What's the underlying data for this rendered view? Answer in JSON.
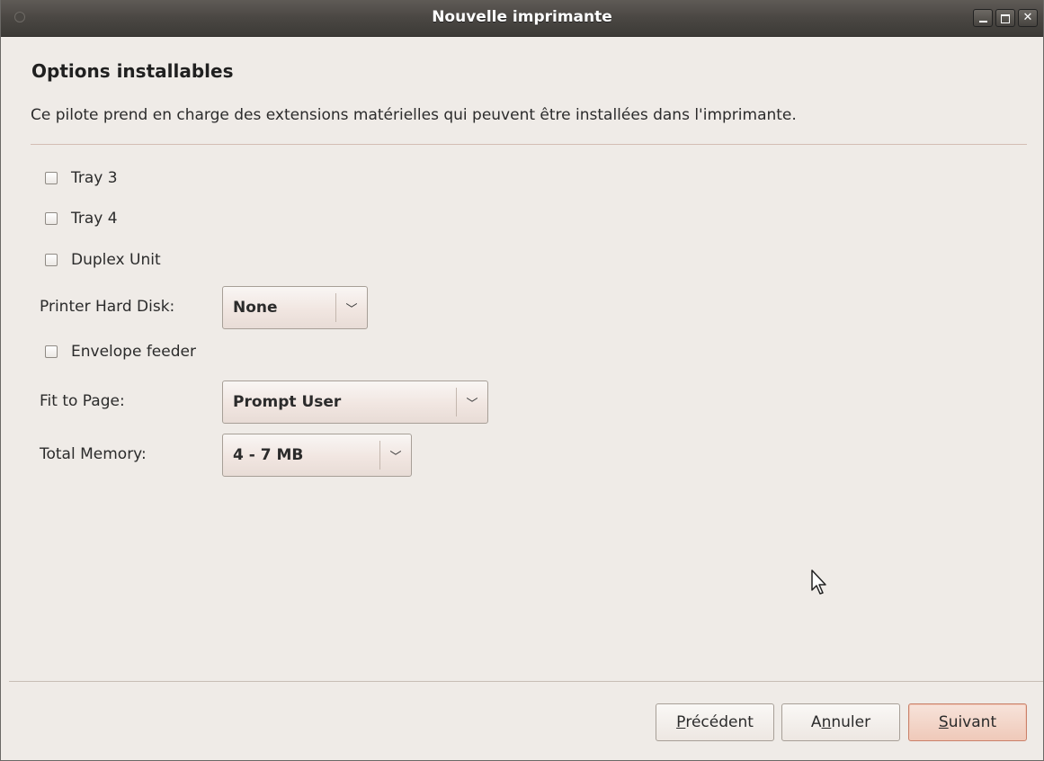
{
  "window": {
    "title": "Nouvelle imprimante",
    "controls": [
      "minimize",
      "maximize",
      "close"
    ]
  },
  "page": {
    "heading": "Options installables",
    "description": "Ce pilote prend en charge des extensions matérielles qui peuvent être installées dans l'imprimante."
  },
  "options": {
    "tray3": {
      "label": "Tray 3",
      "checked": false
    },
    "tray4": {
      "label": "Tray 4",
      "checked": false
    },
    "duplex": {
      "label": "Duplex Unit",
      "checked": false
    },
    "hard_disk": {
      "label": "Printer Hard Disk:",
      "value": "None"
    },
    "envelope": {
      "label": "Envelope feeder",
      "checked": false
    },
    "fit_to_page": {
      "label": "Fit to Page:",
      "value": "Prompt User"
    },
    "total_memory": {
      "label": "Total Memory:",
      "value": "4 - 7 MB"
    }
  },
  "buttons": {
    "previous": {
      "mnemonic": "P",
      "rest": "récédent"
    },
    "cancel": {
      "before": "A",
      "mnemonic": "n",
      "rest": "nuler"
    },
    "next": {
      "mnemonic": "S",
      "rest": "uivant"
    }
  },
  "icons": {
    "combo_arrow": "chevron-down-icon",
    "cursor": "mouse-pointer-icon"
  },
  "colors": {
    "titlebar": "#4a4743",
    "window_bg": "#efebe7",
    "default_button": "#efc9b9"
  }
}
